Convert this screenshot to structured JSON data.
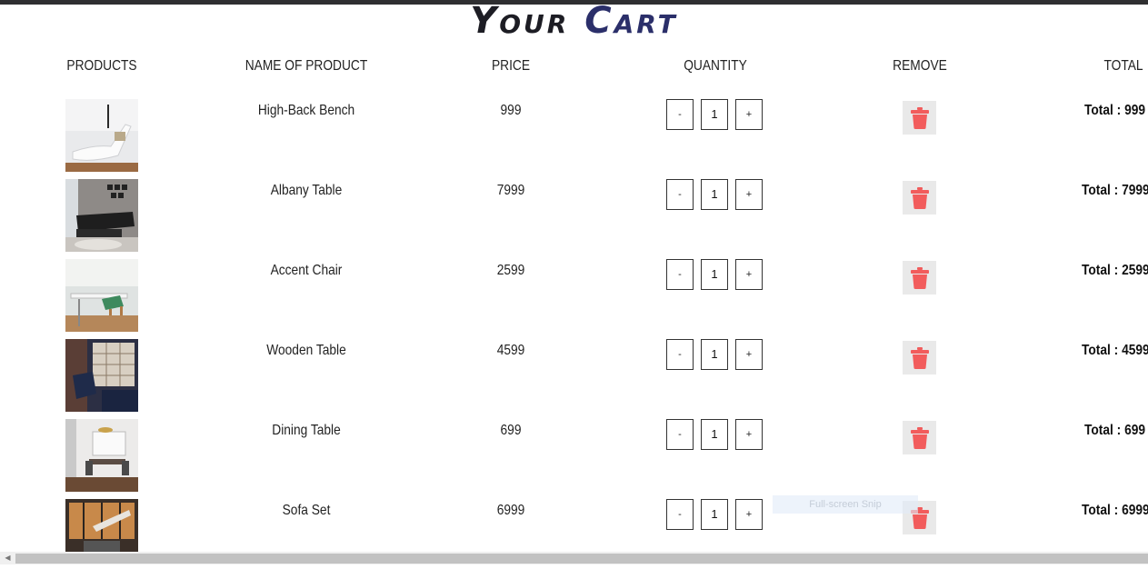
{
  "page_title": {
    "word1": "Your",
    "word2": "Cart"
  },
  "columns": {
    "products": "PRODUCTS",
    "name": "NAME OF PRODUCT",
    "price": "PRICE",
    "quantity": "QUANTITY",
    "remove": "REMOVE",
    "total": "TOTAL"
  },
  "quantity_controls": {
    "minus": "-",
    "plus": "+"
  },
  "rows": [
    {
      "name": "High-Back Bench",
      "price": "999",
      "qty": "1",
      "total": "Total : 999 ("
    },
    {
      "name": "Albany Table",
      "price": "7999",
      "qty": "1",
      "total": "Total : 7999"
    },
    {
      "name": "Accent Chair",
      "price": "2599",
      "qty": "1",
      "total": "Total : 2599"
    },
    {
      "name": "Wooden Table",
      "price": "4599",
      "qty": "1",
      "total": "Total : 4599"
    },
    {
      "name": "Dining Table",
      "price": "699",
      "qty": "1",
      "total": "Total : 699 ("
    },
    {
      "name": "Sofa Set",
      "price": "6999",
      "qty": "1",
      "total": "Total : 6999"
    }
  ],
  "overlay": {
    "snip_label": "Full-screen Snip"
  },
  "colors": {
    "trash": "#f25c5c",
    "title_dark": "#1d1d24",
    "title_accent": "#2b2f6a"
  },
  "icons": {
    "remove": "trash-icon"
  }
}
